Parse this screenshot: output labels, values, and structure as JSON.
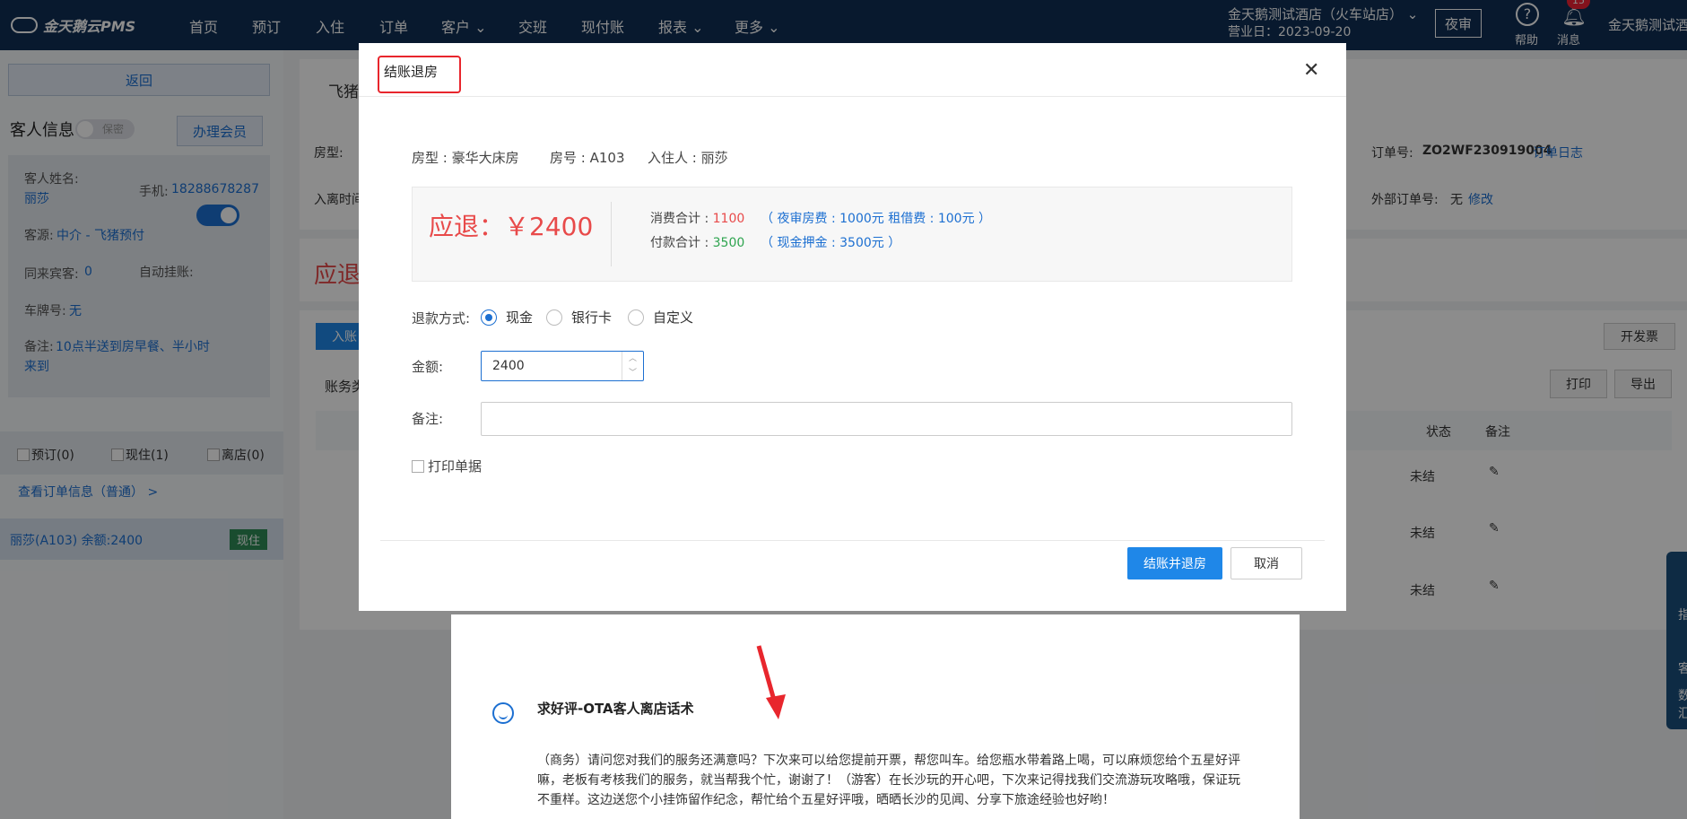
{
  "topnav": {
    "logo": "金天鹅云PMS",
    "menu": [
      "首页",
      "预订",
      "入住",
      "订单",
      "客户",
      "交班",
      "现付账",
      "报表",
      "更多"
    ],
    "hotel_name": "金天鹅测试酒店（火车站店）",
    "business_date": "营业日：2023-09-20",
    "night_audit": "夜审",
    "help": "帮助",
    "message": "消息",
    "message_count": "15",
    "user": "金天鹅测试酒"
  },
  "sidebar": {
    "back": "返回",
    "guest_info": "客人信息",
    "secret": "保密",
    "member": "办理会员",
    "name_label": "客人姓名:",
    "name": "丽莎",
    "phone_label": "手机:",
    "phone": "18288678287",
    "source_label": "客源:",
    "source": "中介 - 飞猪预付",
    "companions_label": "同来宾客:",
    "companions": "0",
    "auto_label": "自动挂账:",
    "plate_label": "车牌号:",
    "plate": "无",
    "note_label": "备注:",
    "note_line1": "10点半送到房早餐、半小时",
    "note_line2": "来到",
    "filter_book": "预订(0)",
    "filter_live": "现住(1)",
    "filter_left": "离店(0)",
    "order_link": "查看订单信息（普通） >",
    "room_row": "丽莎(A103)   余额:2400",
    "room_status": "现住"
  },
  "main": {
    "source_head": "飞猪",
    "room_type_label": "房型:",
    "checkin_time_label": "入离时间",
    "refund_head": "应退",
    "order_no_label": "订单号:",
    "order_no": "ZO2WF230919004",
    "order_log": "订单日志",
    "ext_label": "外部订单号:",
    "ext_value": "无",
    "modify": "修改",
    "enter_btn": "入账",
    "invoice": "开发票",
    "bill_label": "账务类",
    "print": "打印",
    "export": "导出",
    "col_status": "状态",
    "col_note": "备注",
    "rows": [
      "未结",
      "未结",
      "未结"
    ]
  },
  "modal": {
    "title": "结账退房",
    "room_type": "房型 : 豪华大床房",
    "room_no": "房号 : A103",
    "guest": "入住人 : 丽莎",
    "refund": "应退：￥2400",
    "consume_label": "消费合计 : ",
    "consume_value": "1100",
    "consume_detail": "（ 夜审房费 : 1000元  租借费 : 100元 ）",
    "pay_label": "付款合计 : ",
    "pay_value": "3500",
    "pay_detail": "（ 现金押金 : 3500元 ）",
    "refund_method_label": "退款方式:",
    "methods": [
      "现金",
      "银行卡",
      "自定义"
    ],
    "amount_label": "金额:",
    "amount_value": "2400",
    "remark_label": "备注:",
    "print_receipt": "打印单据",
    "confirm": "结账并退房",
    "cancel": "取消"
  },
  "tip": {
    "title": "求好评-OTA客人离店话术",
    "line1": "（商务）请问您对我们的服务还满意吗？下次来可以给您提前开票，帮您叫车。给您瓶水带着路上喝，可以麻烦您给个五星好评",
    "line2": "嘛，老板有考核我们的服务，就当帮我个忙，谢谢了！（游客）在长沙玩的开心吧，下次来记得找我们交流游玩攻略哦，保证玩",
    "line3": "不重样。这边送您个小挂饰留作纪念，帮忙给个五星好评哦，晒晒长沙的见闻、分享下旅途经验也好哟！"
  },
  "right_float": [
    "指",
    "客",
    "数",
    "汇"
  ],
  "colors": {
    "primary": "#1f87e8",
    "nav": "#0f2f55",
    "refund_red": "#e84a4a",
    "highlight": "#e8262d"
  }
}
